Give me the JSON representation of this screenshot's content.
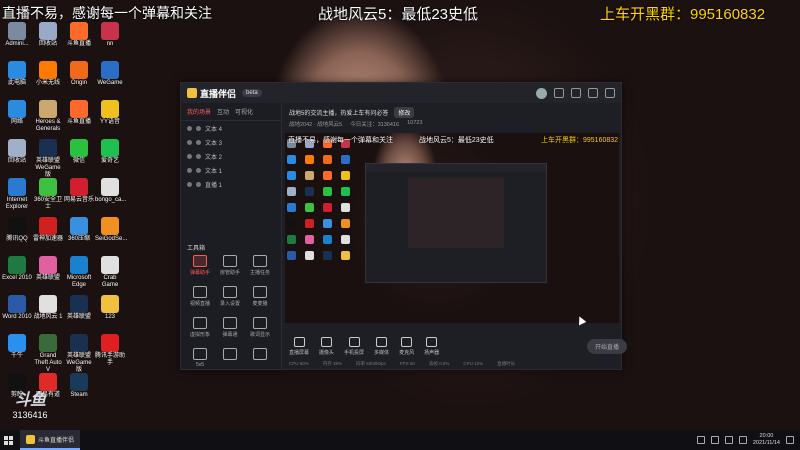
{
  "overlay": {
    "left": "直播不易，感谢每一个弹幕和关注",
    "center": "战地风云5：最低23史低",
    "right": "上车开黑群：995160832"
  },
  "desktop": {
    "icons": [
      {
        "label": "Admini...",
        "color": "#7a8aa0"
      },
      {
        "label": "回收站",
        "color": "#9aa9c8"
      },
      {
        "label": "斗鱼直播",
        "color": "#ff6a2a"
      },
      {
        "label": "nn",
        "color": "#c8324a"
      },
      {
        "label": "此电脑",
        "color": "#2b8be0"
      },
      {
        "label": "小米无线",
        "color": "#ff7a00"
      },
      {
        "label": "Origin",
        "color": "#f06a1a"
      },
      {
        "label": "WeGame",
        "color": "#2a6ec8"
      },
      {
        "label": "网络",
        "color": "#2b8be0"
      },
      {
        "label": "Heroes & Generals",
        "color": "#caa870"
      },
      {
        "label": "斗鱼直播",
        "color": "#ff6a2a"
      },
      {
        "label": "YY语音",
        "color": "#f0c020"
      },
      {
        "label": "回收站",
        "color": "#a0b0c8"
      },
      {
        "label": "英雄联盟 WeGame版",
        "color": "#1a3050"
      },
      {
        "label": "微信",
        "color": "#2ac040"
      },
      {
        "label": "爱奇艺",
        "color": "#20c050"
      },
      {
        "label": "Internet Explorer",
        "color": "#2a7ad0"
      },
      {
        "label": "360安全卫士",
        "color": "#40c040"
      },
      {
        "label": "网易云音乐",
        "color": "#d02030"
      },
      {
        "label": "bongo_ca...",
        "color": "#e0e0e0"
      },
      {
        "label": "腾讯QQ",
        "color": "#111111"
      },
      {
        "label": "雷神加速器",
        "color": "#d02020"
      },
      {
        "label": "360压缩",
        "color": "#3a90e0"
      },
      {
        "label": "SeiGodSe...",
        "color": "#f09020"
      },
      {
        "label": "Excel 2010",
        "color": "#1e7a40"
      },
      {
        "label": "英雄联盟",
        "color": "#e060a0"
      },
      {
        "label": "Microsoft Edge",
        "color": "#1a80d0"
      },
      {
        "label": "Crab Game",
        "color": "#e0e0e0"
      },
      {
        "label": "Word 2010",
        "color": "#2a5aa8"
      },
      {
        "label": "战地风云 1",
        "color": "#e0e0e0"
      },
      {
        "label": "英雄联盟",
        "color": "#1a3050"
      },
      {
        "label": "123",
        "color": "#f0c040"
      },
      {
        "label": "千牛",
        "color": "#2a90f0"
      },
      {
        "label": "Grand Theft Auto V",
        "color": "#3a6a3a"
      },
      {
        "label": "英雄联盟 WeGame版",
        "color": "#1a3050"
      },
      {
        "label": "腾讯手游助手",
        "color": "#e02020"
      },
      {
        "label": "剪映",
        "color": "#111111"
      },
      {
        "label": "网易有道",
        "color": "#e02a2a"
      },
      {
        "label": "Steam",
        "color": "#1a3a5a"
      }
    ]
  },
  "app": {
    "name": "直播伴侣",
    "version": "beta",
    "left_tabs": [
      "我的场景",
      "互动",
      "可视化"
    ],
    "scenes": [
      "文本 4",
      "文本 3",
      "文本 2",
      "文本 1",
      "直播 1"
    ],
    "tools_title": "工具箱",
    "tools": [
      "弹幕助手",
      "房管助手",
      "主播任务",
      "视频直播",
      "录入设置",
      "麦麦播",
      "虚拟形象",
      "弹幕通",
      "歌词显示",
      "5v5",
      "",
      ""
    ],
    "stream_title": "战地5的交流主播，热爱上车有问必答",
    "modify_label": "修改",
    "stream_info": [
      "战地2042 · 战地风云5",
      "今日关注：3136416",
      "10723"
    ],
    "preview": {
      "left_text": "直播不易，感谢每一个弹幕和关注",
      "center_text": "战地风云5：最低23史低",
      "right_text": "上车开黑群：995160832"
    },
    "bottom_buttons": [
      "直播屏幕",
      "摄像头",
      "手机投屏",
      "多媒体",
      "麦克风",
      "扬声器"
    ],
    "start_label": "开始直播",
    "status_items": [
      "CPU 50%",
      "内存 38%",
      "码率 6000kbps",
      "FPS 60",
      "丢帧 0.0%",
      "CPU 12%",
      "直播时长"
    ]
  },
  "watermark": {
    "logo": "斗鱼",
    "room": "3136416"
  },
  "taskbar": {
    "task_label": "斗鱼直播伴侣",
    "time": "20:00",
    "date": "2021/11/14"
  }
}
